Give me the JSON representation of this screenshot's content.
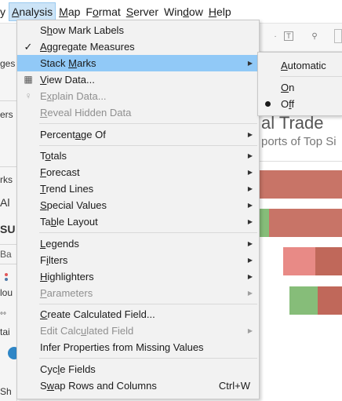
{
  "menubar": [
    {
      "pre": "",
      "ul": "y",
      "post": ""
    },
    {
      "pre": "",
      "ul": "A",
      "post": "nalysis"
    },
    {
      "pre": "",
      "ul": "M",
      "post": "ap"
    },
    {
      "pre": "F",
      "ul": "o",
      "post": "rmat"
    },
    {
      "pre": "",
      "ul": "S",
      "post": "erver"
    },
    {
      "pre": "Win",
      "ul": "d",
      "post": "ow"
    },
    {
      "pre": "",
      "ul": "H",
      "post": "elp"
    }
  ],
  "left_strip": {
    "t1": "ges",
    "t2": "ers",
    "t3": "rks",
    "t4": "Al",
    "t5": "SU",
    "t6": "Ba",
    "t7": "lou",
    "t8": "tai",
    "t9": "Sh"
  },
  "toolbar": {
    "btn1": "T",
    "btn2": "⚲"
  },
  "viz": {
    "title": "al Trade",
    "subtitle": "ports of Top Si",
    "colors": {
      "red": "#c87467",
      "pink": "#e88a86",
      "green": "#86bd79",
      "dark_red": "#c0685a"
    }
  },
  "menu": {
    "show_mark_labels": {
      "pre": "S",
      "ul": "h",
      "post": "ow Mark Labels"
    },
    "aggregate_measures": {
      "pre": "",
      "ul": "A",
      "post": "ggregate Measures"
    },
    "stack_marks": {
      "pre": "Stack ",
      "ul": "M",
      "post": "arks"
    },
    "view_data": {
      "pre": "",
      "ul": "V",
      "post": "iew Data..."
    },
    "explain_data": {
      "pre": "E",
      "ul": "x",
      "post": "plain Data..."
    },
    "reveal_hidden": {
      "pre": "",
      "ul": "R",
      "post": "eveal Hidden Data"
    },
    "percentage_of": {
      "pre": "Percent",
      "ul": "a",
      "post": "ge Of"
    },
    "totals": {
      "pre": "T",
      "ul": "o",
      "post": "tals"
    },
    "forecast": {
      "pre": "",
      "ul": "F",
      "post": "orecast"
    },
    "trend_lines": {
      "pre": "",
      "ul": "T",
      "post": "rend Lines"
    },
    "special_values": {
      "pre": "",
      "ul": "S",
      "post": "pecial Values"
    },
    "table_layout": {
      "pre": "Ta",
      "ul": "b",
      "post": "le Layout"
    },
    "legends": {
      "pre": "",
      "ul": "L",
      "post": "egends"
    },
    "filters": {
      "pre": "F",
      "ul": "i",
      "post": "lters"
    },
    "highlighters": {
      "pre": "",
      "ul": "H",
      "post": "ighlighters"
    },
    "parameters": {
      "pre": "",
      "ul": "P",
      "post": "arameters"
    },
    "create_calc": {
      "pre": "",
      "ul": "C",
      "post": "reate Calculated Field..."
    },
    "edit_calc": {
      "pre": "Edit Calc",
      "ul": "u",
      "post": "lated Field"
    },
    "infer_props": {
      "pre": "Infer Properties from Missing Values",
      "ul": "",
      "post": ""
    },
    "cycle_fields": {
      "pre": "Cyc",
      "ul": "l",
      "post": "e Fields"
    },
    "swap_rows": {
      "pre": "S",
      "ul": "w",
      "post": "ap Rows and Columns"
    },
    "swap_shortcut": "Ctrl+W",
    "arrow": "▶",
    "check": "✓"
  },
  "submenu": {
    "automatic": {
      "pre": "",
      "ul": "A",
      "post": "utomatic"
    },
    "on": {
      "pre": "",
      "ul": "O",
      "post": "n"
    },
    "off": {
      "pre": "O",
      "ul": "f",
      "post": "f"
    }
  },
  "icons": {
    "view_data": "▦",
    "explain_data": "♀"
  }
}
